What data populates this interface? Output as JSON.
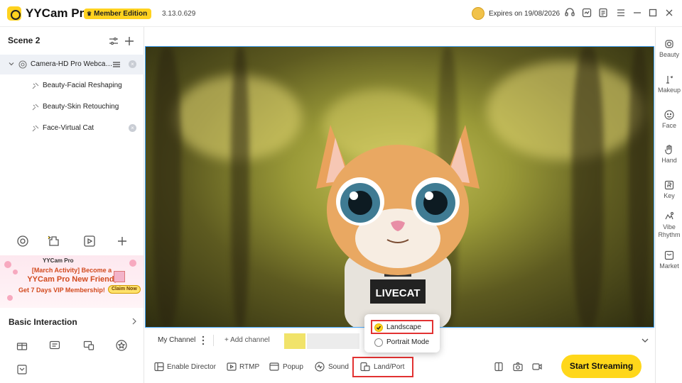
{
  "app": {
    "name": "YYCam Pro",
    "edition": "Member Edition",
    "version": "3.13.0.629",
    "expires": "Expires on 19/08/2026"
  },
  "sidebar": {
    "scene_title": "Scene 2",
    "sources": [
      {
        "label": "Camera-HD Pro Webca…"
      },
      {
        "label": "Beauty-Facial Reshaping"
      },
      {
        "label": "Beauty-Skin Retouching"
      },
      {
        "label": "Face-Virtual Cat"
      }
    ],
    "promo": {
      "brand": "YYCam Pro",
      "line1": "[March Activity] Become a",
      "line2": "YYCam Pro New Friend,",
      "line3": "Get 7 Days VIP Membership!",
      "claim": "Claim Now"
    },
    "basic_title": "Basic Interaction"
  },
  "channel": {
    "name": "My Channel",
    "add": "+ Add channel"
  },
  "bottom": {
    "enable_director": "Enable Director",
    "rtmp": "RTMP",
    "popup": "Popup",
    "sound": "Sound",
    "land_port": "Land/Port",
    "start": "Start Streaming"
  },
  "orientation_menu": {
    "options": [
      {
        "label": "Landscape",
        "selected": true
      },
      {
        "label": "Portrait Mode",
        "selected": false
      }
    ]
  },
  "preview": {
    "shirt_text": "LIVECAT"
  },
  "rightbar": [
    {
      "label": "Beauty",
      "icon": "beauty-icon"
    },
    {
      "label": "Makeup",
      "icon": "makeup-icon"
    },
    {
      "label": "Face",
      "icon": "face-icon"
    },
    {
      "label": "Hand",
      "icon": "hand-icon"
    },
    {
      "label": "Key",
      "icon": "key-icon"
    },
    {
      "label": "Vibe Rhythm",
      "icon": "vibe-rhythm-icon"
    },
    {
      "label": "Market",
      "icon": "market-icon"
    }
  ],
  "colors": {
    "accent": "#ffd71a",
    "highlight_red": "#e23232",
    "preview_border": "#3fa2f7"
  }
}
